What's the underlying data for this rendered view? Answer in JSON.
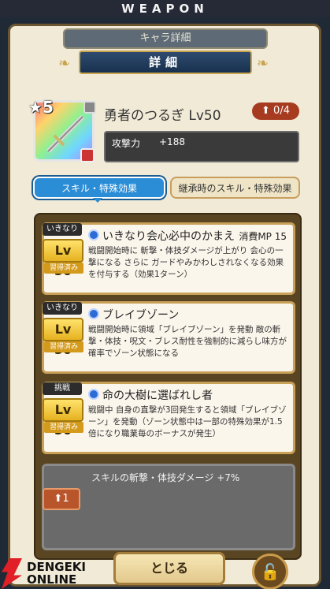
{
  "header": {
    "title": "WEAPON"
  },
  "breadcrumb": "キャラ詳細",
  "title": "詳細",
  "weapon": {
    "rarity": "5",
    "name": "勇者のつるぎ Lv50",
    "count": "0/4",
    "stat_label": "攻撃力",
    "stat_value": "+188"
  },
  "tabs": [
    "スキル・特殊効果",
    "継承時のスキル・特殊効果"
  ],
  "skills": [
    {
      "tag": "いきなり",
      "level": "Lv 50",
      "learned": "習得済み",
      "name": "いきなり会心必中のかまえ",
      "mp": "消費MP 15",
      "desc": "戦闘開始時に 斬撃・体技ダメージが上がり 会心の一撃になる さらに ガードやみかわしされなくなる効果を付与する（効果1ターン）"
    },
    {
      "tag": "いきなり",
      "level": "Lv 50",
      "learned": "習得済み",
      "name": "ブレイブゾーン",
      "mp": "",
      "desc": "戦闘開始時に領域「ブレイブゾーン」を発動 敵の斬撃・体技・呪文・ブレス耐性を強制的に減らし味方が確率でゾーン状態になる"
    },
    {
      "tag": "挑戦",
      "level": "Lv 50",
      "learned": "習得済み",
      "name": "命の大樹に選ばれし者",
      "mp": "",
      "desc": "戦闘中 自身の直撃が3回発生すると領域「ブレイブゾーン」を発動（ゾーン状態中は一部の特殊効果が1.5倍になり職業毎のボーナスが発生）"
    }
  ],
  "locked": {
    "text": "スキルの斬撃・体技ダメージ +7%",
    "unlock": "1"
  },
  "buttons": {
    "close": "とじる"
  },
  "watermark": {
    "line1": "DENGEKI",
    "line2": "ONLINE"
  }
}
